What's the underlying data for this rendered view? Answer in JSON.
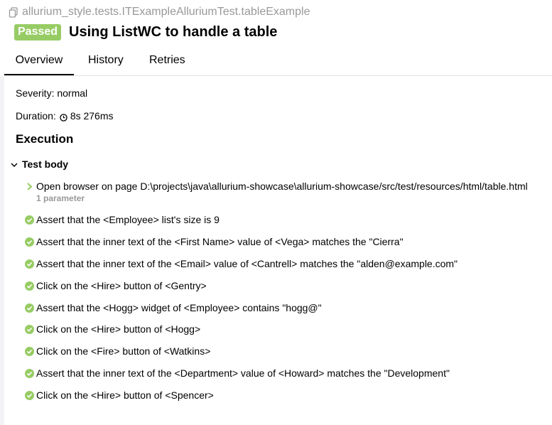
{
  "breadcrumb": {
    "text": "allurium_style.tests.ITExampleAlluriumTest.tableExample",
    "icon": "copy-icon"
  },
  "header": {
    "status": "Passed",
    "status_color": "#97cc64",
    "title": "Using ListWC to handle a table"
  },
  "tabs": [
    {
      "label": "Overview",
      "active": true
    },
    {
      "label": "History",
      "active": false
    },
    {
      "label": "Retries",
      "active": false
    }
  ],
  "overview": {
    "severity_label": "Severity: normal",
    "duration_label": "Duration:",
    "duration_value": "8s 276ms"
  },
  "execution": {
    "title": "Execution",
    "test_body_label": "Test body",
    "steps": [
      {
        "text": "Open browser on page D:\\projects\\java\\allurium-showcase\\allurium-showcase/src/test/resources/html/table.html",
        "icon": "chevron-right-icon",
        "param": "1 parameter"
      },
      {
        "text": "Assert that the <Employee> list's size is 9",
        "icon": "check-circle-icon"
      },
      {
        "text": "Assert that the inner text of the <First Name> value of <Vega> matches the \"Cierra\"",
        "icon": "check-circle-icon"
      },
      {
        "text": "Assert that the inner text of the <Email> value of <Cantrell> matches the \"alden@example.com\"",
        "icon": "check-circle-icon"
      },
      {
        "text": "Click on the <Hire> button of <Gentry>",
        "icon": "check-circle-icon"
      },
      {
        "text": "Assert that the <Hogg> widget of <Employee> contains \"hogg@\"",
        "icon": "check-circle-icon"
      },
      {
        "text": "Click on the <Hire> button of <Hogg>",
        "icon": "check-circle-icon"
      },
      {
        "text": "Click on the <Fire> button of <Watkins>",
        "icon": "check-circle-icon"
      },
      {
        "text": "Assert that the inner text of the <Department> value of <Howard> matches the \"Development\"",
        "icon": "check-circle-icon"
      },
      {
        "text": "Click on the <Hire> button of <Spencer>",
        "icon": "check-circle-icon"
      }
    ]
  },
  "colors": {
    "passed": "#97cc64",
    "muted": "#999999"
  }
}
